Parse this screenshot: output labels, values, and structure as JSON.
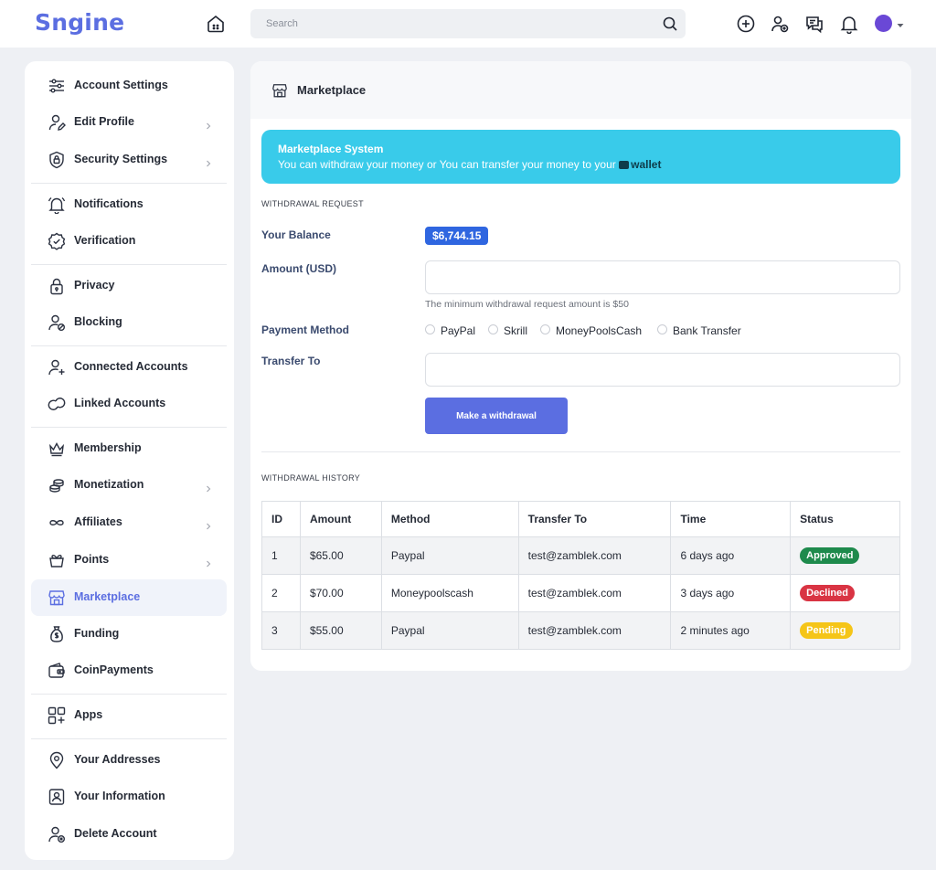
{
  "app": {
    "logo": "Sngine"
  },
  "search": {
    "placeholder": "Search"
  },
  "sidebar": {
    "items": [
      {
        "label": "Account Settings",
        "icon": "sliders-icon"
      },
      {
        "label": "Edit Profile",
        "icon": "user-edit-icon",
        "chevron": true
      },
      {
        "label": "Security Settings",
        "icon": "shield-icon",
        "chevron": true
      },
      {
        "label": "Notifications",
        "icon": "bell-icon"
      },
      {
        "label": "Verification",
        "icon": "verified-badge-icon"
      },
      {
        "label": "Privacy",
        "icon": "lock-icon"
      },
      {
        "label": "Blocking",
        "icon": "user-block-icon"
      },
      {
        "label": "Connected Accounts",
        "icon": "user-plus-icon"
      },
      {
        "label": "Linked Accounts",
        "icon": "link-icon"
      },
      {
        "label": "Membership",
        "icon": "crown-icon"
      },
      {
        "label": "Monetization",
        "icon": "coins-icon",
        "chevron": true
      },
      {
        "label": "Affiliates",
        "icon": "infinity-icon",
        "chevron": true
      },
      {
        "label": "Points",
        "icon": "gift-icon",
        "chevron": true
      },
      {
        "label": "Marketplace",
        "icon": "store-icon",
        "active": true
      },
      {
        "label": "Funding",
        "icon": "money-bag-icon"
      },
      {
        "label": "CoinPayments",
        "icon": "wallet-icon"
      },
      {
        "label": "Apps",
        "icon": "apps-icon"
      },
      {
        "label": "Your Addresses",
        "icon": "map-pin-icon"
      },
      {
        "label": "Your Information",
        "icon": "id-card-icon"
      },
      {
        "label": "Delete Account",
        "icon": "user-remove-icon"
      }
    ]
  },
  "main": {
    "title": "Marketplace",
    "alert": {
      "title": "Marketplace System",
      "text": "You can withdraw your money or You can transfer your money to your",
      "link": "wallet"
    },
    "withdrawal_request": {
      "section_label": "WITHDRAWAL REQUEST",
      "balance_label": "Your Balance",
      "balance_value": "$6,744.15",
      "amount_label": "Amount (USD)",
      "amount_value": "",
      "amount_hint": "The minimum withdrawal request amount is $50",
      "method_label": "Payment Method",
      "methods": [
        "PayPal",
        "Skrill",
        "MoneyPoolsCash",
        "Bank Transfer"
      ],
      "transfer_label": "Transfer To",
      "transfer_value": "",
      "button": "Make a withdrawal"
    },
    "history": {
      "section_label": "WITHDRAWAL HISTORY",
      "columns": [
        "ID",
        "Amount",
        "Method",
        "Transfer To",
        "Time",
        "Status"
      ],
      "rows": [
        {
          "id": "1",
          "amount": "$65.00",
          "method": "Paypal",
          "to": "test@zamblek.com",
          "time": "6 days ago",
          "status": "Approved",
          "status_color": "#1e8a4c"
        },
        {
          "id": "2",
          "amount": "$70.00",
          "method": "Moneypoolscash",
          "to": "test@zamblek.com",
          "time": "3 days ago",
          "status": "Declined",
          "status_color": "#d93443"
        },
        {
          "id": "3",
          "amount": "$55.00",
          "method": "Paypal",
          "to": "test@zamblek.com",
          "time": "2 minutes ago",
          "status": "Pending",
          "status_color": "#f5c518"
        }
      ]
    }
  },
  "colors": {
    "accent": "#5b6ee1",
    "alert_bg": "#39cbea",
    "balance_badge": "#2f66e0"
  }
}
